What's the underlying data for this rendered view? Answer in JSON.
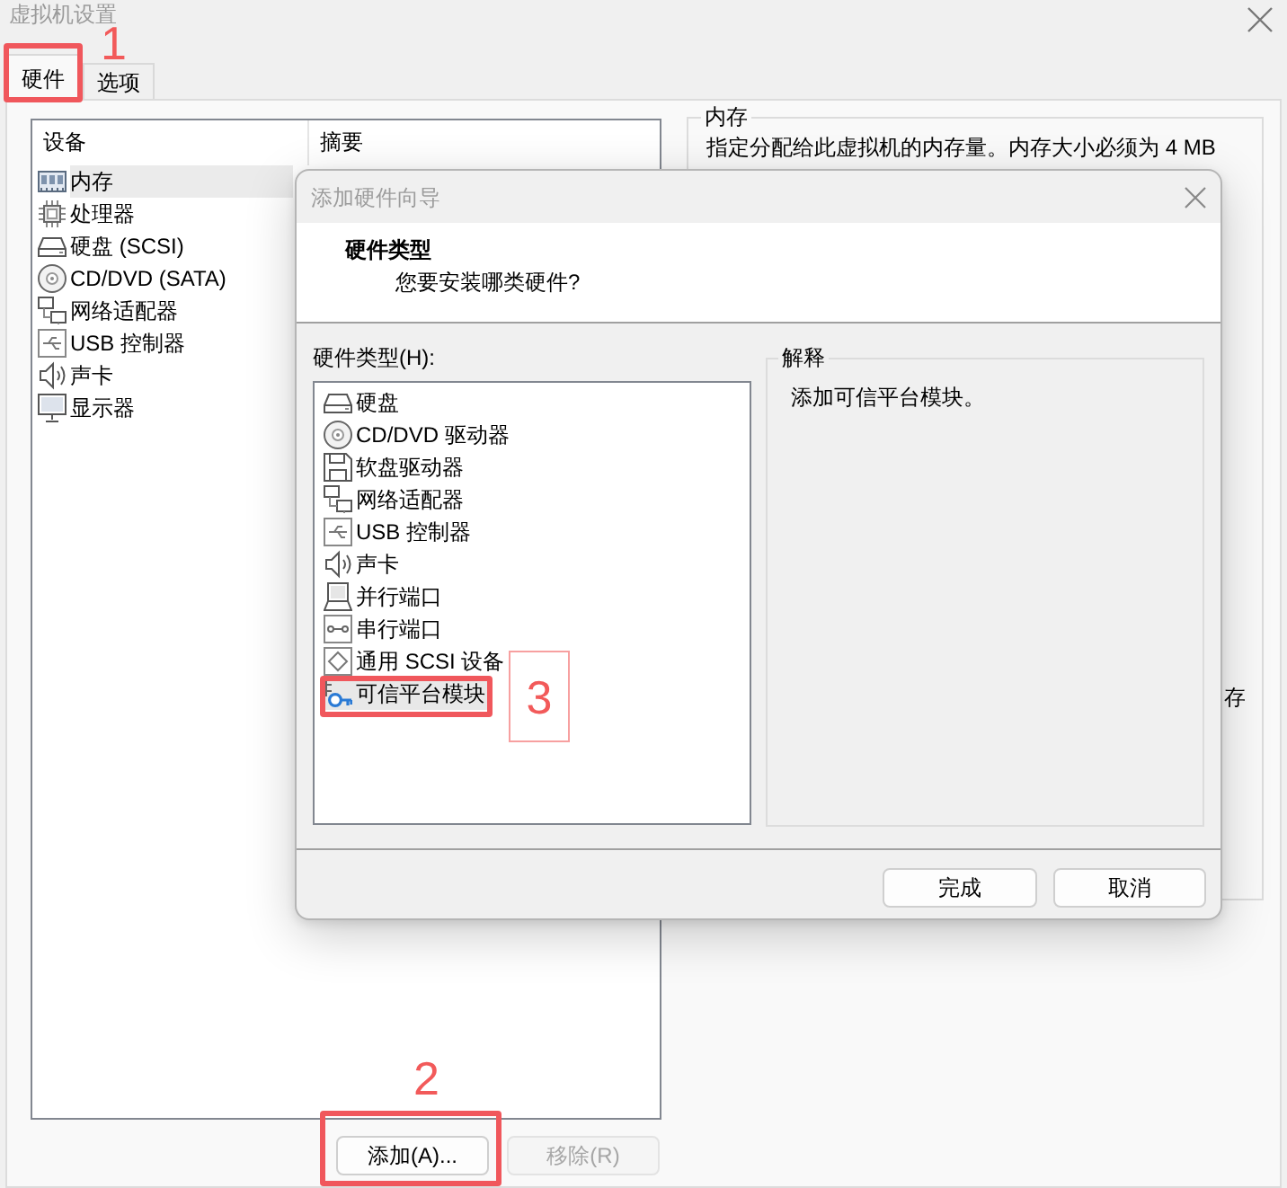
{
  "window": {
    "title": "虚拟机设置"
  },
  "tabs": [
    {
      "label": "硬件",
      "selected": true,
      "callout": {
        "label": "1",
        "boxed": false
      }
    },
    {
      "label": "选项",
      "selected": false
    }
  ],
  "devices": {
    "columns": [
      "设备",
      "摘要"
    ],
    "rows": [
      {
        "kind": "memory",
        "name": "内存",
        "selected": true
      },
      {
        "kind": "cpu",
        "name": "处理器",
        "selected": false
      },
      {
        "kind": "disk",
        "name": "硬盘 (SCSI)",
        "selected": false
      },
      {
        "kind": "cdrom",
        "name": "CD/DVD (SATA)",
        "selected": false
      },
      {
        "kind": "network",
        "name": "网络适配器",
        "selected": false
      },
      {
        "kind": "usb",
        "name": "USB 控制器",
        "selected": false
      },
      {
        "kind": "sound",
        "name": "声卡",
        "selected": false
      },
      {
        "kind": "display",
        "name": "显示器",
        "selected": false
      }
    ]
  },
  "device_buttons": [
    {
      "label": "添加(A)...",
      "disabled": false,
      "callout": {
        "label": "2",
        "boxed": false
      }
    },
    {
      "label": "移除(R)",
      "disabled": true
    }
  ],
  "memory_group": {
    "title": "内存",
    "text": "指定分配给此虚拟机的内存量。内存大小必须为 4 MB",
    "fragment": "存"
  },
  "dialog": {
    "title": "添加硬件向导",
    "heading": "硬件类型",
    "subheading": "您要安装哪类硬件?",
    "list_label": "硬件类型(H):",
    "items": [
      {
        "kind": "disk",
        "name": "硬盘",
        "selected": false
      },
      {
        "kind": "cdrom",
        "name": "CD/DVD 驱动器",
        "selected": false
      },
      {
        "kind": "floppy",
        "name": "软盘驱动器",
        "selected": false
      },
      {
        "kind": "network",
        "name": "网络适配器",
        "selected": false
      },
      {
        "kind": "usb",
        "name": "USB 控制器",
        "selected": false
      },
      {
        "kind": "sound",
        "name": "声卡",
        "selected": false
      },
      {
        "kind": "parallel",
        "name": "并行端口",
        "selected": false
      },
      {
        "kind": "serial",
        "name": "串行端口",
        "selected": false
      },
      {
        "kind": "scsi",
        "name": "通用 SCSI 设备",
        "selected": false
      },
      {
        "kind": "tpm",
        "name": "可信平台模块",
        "selected": true,
        "callout": {
          "label": "3",
          "boxed": true
        }
      }
    ],
    "explanation": {
      "title": "解释",
      "text": "添加可信平台模块。"
    },
    "buttons": [
      {
        "label": "完成"
      },
      {
        "label": "取消"
      }
    ]
  }
}
